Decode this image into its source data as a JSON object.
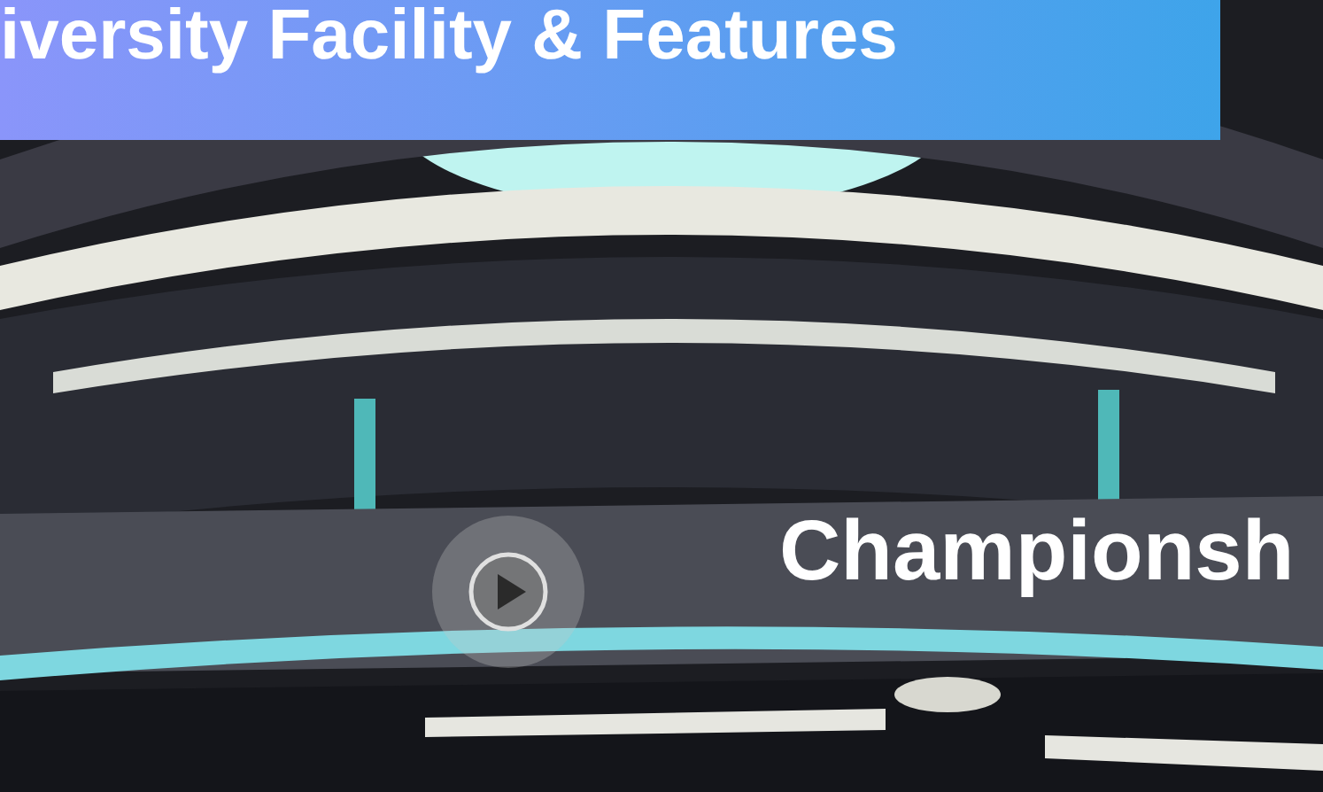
{
  "banner": {
    "title": "iversity Facility & Features"
  },
  "video": {
    "caption": "Championsh"
  }
}
